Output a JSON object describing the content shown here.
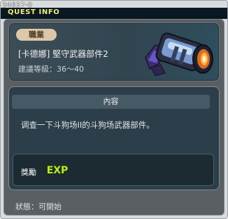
{
  "window": {
    "quest_id": "34637-0",
    "title": "QUEST INFO"
  },
  "header": {
    "job_badge": "職業",
    "quest_name": "[卡德娜] 堅守武器部件2",
    "level_requirement": "建議等級：36～40",
    "quest_icon": "weapon-part-icon"
  },
  "content": {
    "header_label": "內容",
    "description": "调查一下斗狗场II的斗狗场武器部件。"
  },
  "reward": {
    "label": "獎勵",
    "exp_text": "EXP",
    "exp_icon": "exp-icon"
  },
  "status": {
    "text": "狀態：可開始"
  },
  "colors": {
    "title_text": "#f3ea79",
    "exp_fill": "#b8ec2a"
  }
}
